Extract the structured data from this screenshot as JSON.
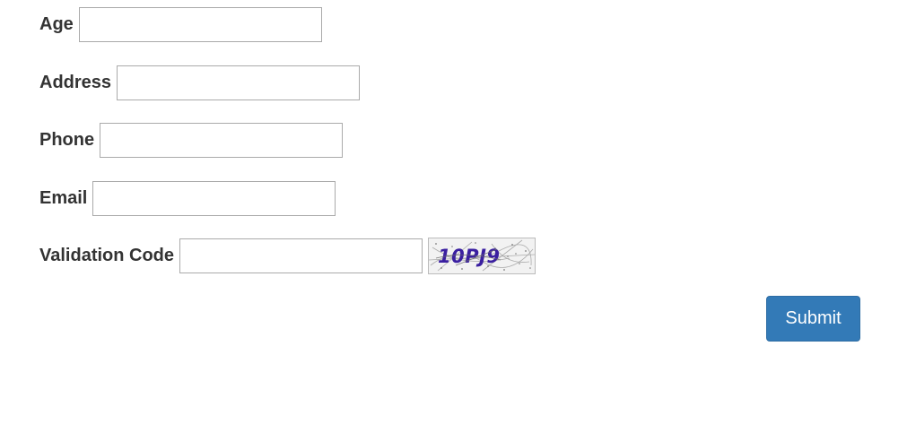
{
  "form": {
    "fields": {
      "age": {
        "label": "Age",
        "value": ""
      },
      "address": {
        "label": "Address",
        "value": ""
      },
      "phone": {
        "label": "Phone",
        "value": ""
      },
      "email": {
        "label": "Email",
        "value": ""
      },
      "validation_code": {
        "label": "Validation Code",
        "value": ""
      }
    },
    "captcha": {
      "text": "10PJ9"
    },
    "submit_label": "Submit"
  },
  "colors": {
    "button_bg": "#337ab7",
    "label_text": "#333333",
    "captcha_text": "#3a1fa0"
  }
}
